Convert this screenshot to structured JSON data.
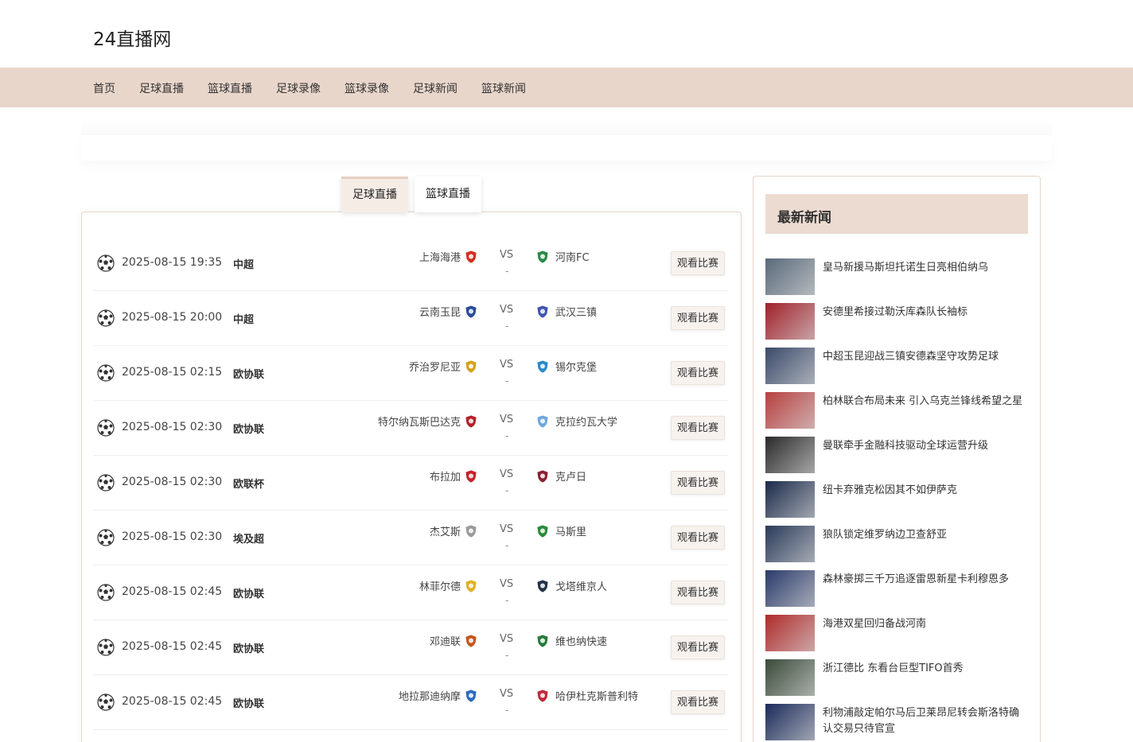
{
  "site": {
    "logo": "24直播网"
  },
  "nav": [
    {
      "label": "首页"
    },
    {
      "label": "足球直播"
    },
    {
      "label": "篮球直播"
    },
    {
      "label": "足球录像"
    },
    {
      "label": "篮球录像"
    },
    {
      "label": "足球新闻"
    },
    {
      "label": "篮球新闻"
    }
  ],
  "tabs": [
    {
      "label": "足球直播",
      "active": true
    },
    {
      "label": "篮球直播",
      "active": false
    }
  ],
  "matches": [
    {
      "time": "2025-08-15 19:35",
      "league": "中超",
      "home": "上海海港",
      "away": "河南FC",
      "vs": "VS",
      "score": "-",
      "button": "观看比赛",
      "home_color": "#d62c1f",
      "away_color": "#2d8a4a"
    },
    {
      "time": "2025-08-15 20:00",
      "league": "中超",
      "home": "云南玉昆",
      "away": "武汉三镇",
      "vs": "VS",
      "score": "-",
      "button": "观看比赛",
      "home_color": "#2a4c9a",
      "away_color": "#4055b3"
    },
    {
      "time": "2025-08-15 02:15",
      "league": "欧协联",
      "home": "乔治罗尼亚",
      "away": "锡尔克堡",
      "vs": "VS",
      "score": "-",
      "button": "观看比赛",
      "home_color": "#d3a21a",
      "away_color": "#2a8ac9"
    },
    {
      "time": "2025-08-15 02:30",
      "league": "欧协联",
      "home": "特尔纳瓦斯巴达克",
      "away": "克拉约瓦大学",
      "vs": "VS",
      "score": "-",
      "button": "观看比赛",
      "home_color": "#b3202a",
      "away_color": "#6ea8e0"
    },
    {
      "time": "2025-08-15 02:30",
      "league": "欧联杯",
      "home": "布拉加",
      "away": "克卢日",
      "vs": "VS",
      "score": "-",
      "button": "观看比赛",
      "home_color": "#c8202a",
      "away_color": "#8a2030"
    },
    {
      "time": "2025-08-15 02:30",
      "league": "埃及超",
      "home": "杰艾斯",
      "away": "马斯里",
      "vs": "VS",
      "score": "-",
      "button": "观看比赛",
      "home_color": "#9a9a9a",
      "away_color": "#2a8a3a"
    },
    {
      "time": "2025-08-15 02:45",
      "league": "欧协联",
      "home": "林菲尔德",
      "away": "戈塔维京人",
      "vs": "VS",
      "score": "-",
      "button": "观看比赛",
      "home_color": "#e0b020",
      "away_color": "#223344"
    },
    {
      "time": "2025-08-15 02:45",
      "league": "欧协联",
      "home": "邓迪联",
      "away": "维也纳快速",
      "vs": "VS",
      "score": "-",
      "button": "观看比赛",
      "home_color": "#c4561c",
      "away_color": "#2a7a3a"
    },
    {
      "time": "2025-08-15 02:45",
      "league": "欧协联",
      "home": "地拉那迪纳摩",
      "away": "哈伊杜克斯普利特",
      "vs": "VS",
      "score": "-",
      "button": "观看比赛",
      "home_color": "#2a6ac0",
      "away_color": "#c02a3a"
    }
  ],
  "news": {
    "title": "最新新闻",
    "items": [
      {
        "text": "皇马新援马斯坦托诺生日亮相伯纳乌",
        "thumb_color": "#5a6a7a"
      },
      {
        "text": "安德里希接过勒沃库森队长袖标",
        "thumb_color": "#a0202a"
      },
      {
        "text": "中超玉昆迎战三镇安德森坚守攻势足球",
        "thumb_color": "#3a4a6a"
      },
      {
        "text": "柏林联合布局未来 引入乌克兰锋线希望之星",
        "thumb_color": "#b84040"
      },
      {
        "text": "曼联牵手金融科技驱动全球运营升级",
        "thumb_color": "#2a2a2a"
      },
      {
        "text": "纽卡弃雅克松因其不如伊萨克",
        "thumb_color": "#1a2a4a"
      },
      {
        "text": "狼队锁定维罗纳边卫查舒亚",
        "thumb_color": "#2a3a5a"
      },
      {
        "text": "森林豪掷三千万追逐雷恩新星卡利穆恩多",
        "thumb_color": "#2a3a6a"
      },
      {
        "text": "海港双星回归备战河南",
        "thumb_color": "#b02a2a"
      },
      {
        "text": "浙江德比 东看台巨型TIFO首秀",
        "thumb_color": "#3a4a3a"
      },
      {
        "text": "利物浦敲定帕尔马后卫莱昂尼转会斯洛特确认交易只待官宣",
        "thumb_color": "#1a2a5a"
      }
    ]
  }
}
